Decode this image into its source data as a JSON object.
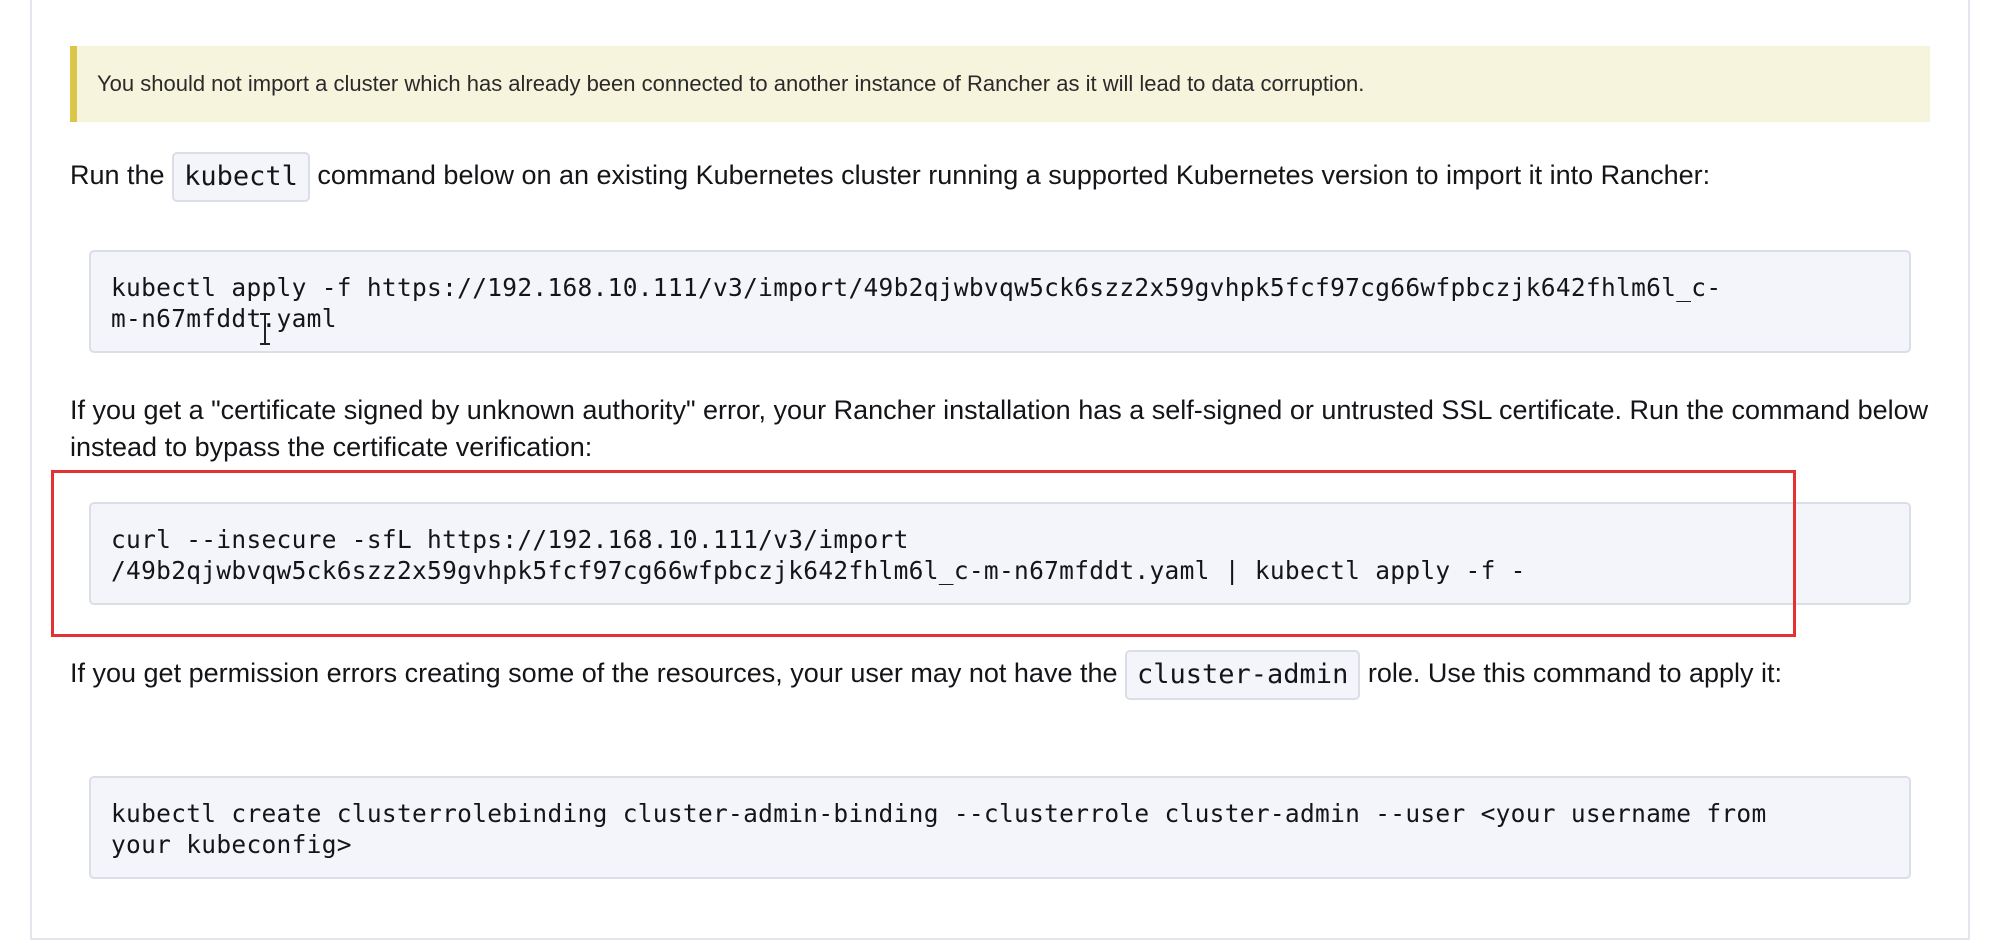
{
  "warning_banner": {
    "text": "You should not import a cluster which has already been connected to another instance of Rancher as it will lead to data corruption.",
    "color": "#dcc64a"
  },
  "section1": {
    "text_before": "Run the ",
    "code": "kubectl",
    "text_after": " command below on an existing Kubernetes cluster running a supported Kubernetes version to import it into Rancher:",
    "command_line1": "kubectl apply -f https://192.168.10.111/v3/import/49b2qjwbvqw5ck6szz2x59gvhpk5fcf97cg66wfpbczjk642fhlm6l_c-",
    "command_line2": "m-n67mfddt.yaml"
  },
  "section2": {
    "text": "If you get a \"certificate signed by unknown authority\" error, your Rancher installation has a self-signed or untrusted SSL certificate. Run the command below instead to bypass the certificate verification:",
    "command_line1": "curl --insecure -sfL https://192.168.10.111/v3/import",
    "command_line2": "/49b2qjwbvqw5ck6szz2x59gvhpk5fcf97cg66wfpbczjk642fhlm6l_c-m-n67mfddt.yaml | kubectl apply -f -",
    "highlight_color": "#e33232"
  },
  "section3": {
    "text_before": "If you get permission errors creating some of the resources, your user may not have the ",
    "code": "cluster-admin",
    "text_after": " role. Use this command to apply it:",
    "command_line1": "kubectl create clusterrolebinding cluster-admin-binding --clusterrole cluster-admin --user <your username from",
    "command_line2": "your kubeconfig>"
  },
  "cursor": {
    "icon": "text-cursor-icon"
  }
}
